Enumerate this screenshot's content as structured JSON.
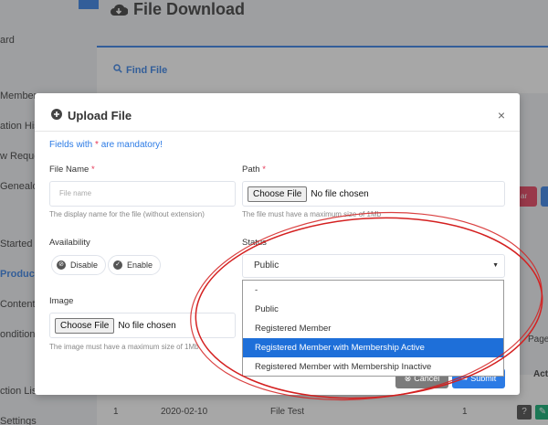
{
  "page": {
    "title": "File Download",
    "find_file_label": "Find File"
  },
  "sidebar": {
    "items": [
      {
        "label": "ard"
      },
      {
        "label": "Member"
      },
      {
        "label": "ation Histo"
      },
      {
        "label": "w Reque"
      },
      {
        "label": "Genealo"
      },
      {
        "label": "Started"
      },
      {
        "label": "Product",
        "active": true
      },
      {
        "label": "Content"
      },
      {
        "label": "onditions"
      },
      {
        "label": "ction List"
      },
      {
        "label": "Settings"
      }
    ]
  },
  "background": {
    "page_label": "Page:",
    "actions_header": "Acti",
    "row": {
      "num": "1",
      "date": "2020-02-10",
      "name": "File Test",
      "count": "1"
    },
    "side_button_text": "ar"
  },
  "modal": {
    "title": "Upload File",
    "close_symbol": "×",
    "mandatory_prefix": "Fields with ",
    "mandatory_star": "*",
    "mandatory_suffix": " are mandatory!",
    "file_name": {
      "label": "File Name ",
      "star": "*",
      "placeholder": "File name",
      "help": "The display name for the file (without extension)"
    },
    "path": {
      "label": "Path ",
      "star": "*",
      "button": "Choose File",
      "status": "No file chosen",
      "help": "The file must have a maximum size of 1Mb"
    },
    "availability": {
      "label": "Availability",
      "disable": "Disable",
      "enable": "Enable"
    },
    "status": {
      "label": "Status",
      "value": "Public",
      "options": [
        "-",
        "Public",
        "Registered Member",
        "Registered Member with Membership Active",
        "Registered Member with Membership Inactive"
      ],
      "highlighted_index": 3
    },
    "image": {
      "label": "Image",
      "button": "Choose File",
      "status": "No file chosen",
      "help": "The image must have a maximum size of 1Mb"
    },
    "cancel_label": "Cancel",
    "submit_label": "Submit"
  },
  "colors": {
    "accent": "#2c7be5",
    "required_star": "#e63757",
    "highlight": "#1e6fd9",
    "annotation": "#d42020",
    "danger": "#e63757",
    "success": "#00d27a"
  },
  "icons": [
    "cloud-download-icon",
    "search-icon",
    "plus-circle-icon",
    "close-icon",
    "chevron-down-icon",
    "ban-icon",
    "check-icon",
    "submit-icon",
    "question-icon",
    "edit-icon"
  ]
}
